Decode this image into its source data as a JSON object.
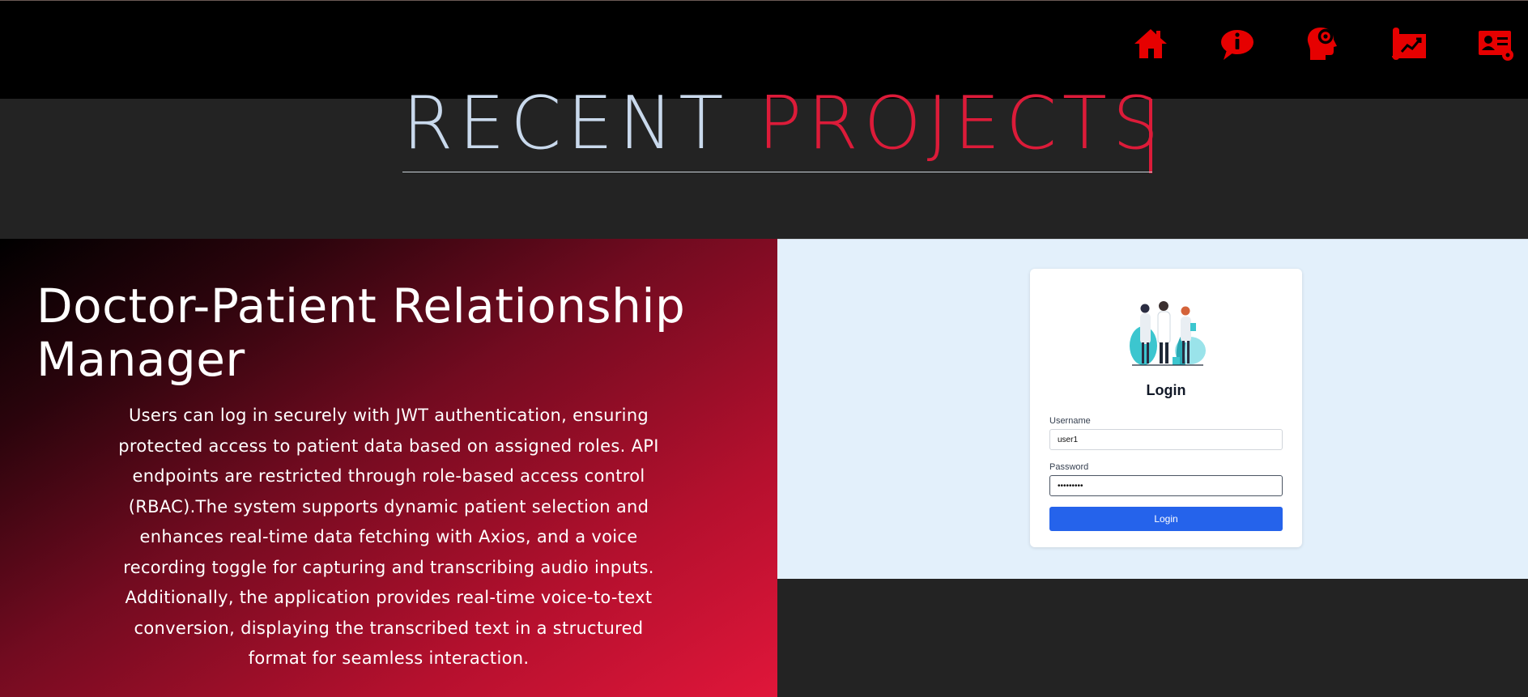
{
  "nav": {
    "icons": [
      "home-icon",
      "about-icon",
      "skills-icon",
      "projects-icon",
      "contact-icon"
    ],
    "accent": "#e60000"
  },
  "heading": {
    "word1": "RECENT",
    "word2": "PROJECTS"
  },
  "project": {
    "title": "Doctor-Patient Relationship Manager",
    "description": "Users can log in securely with JWT authentication, ensuring protected access to patient data based on assigned roles. API endpoints are restricted through role-based access control (RBAC).The system supports dynamic patient selection and enhances real-time data fetching with Axios, and a voice recording toggle for capturing and transcribing audio inputs. Additionally, the application provides real-time voice-to-text conversion, displaying the transcribed text in a structured format for seamless interaction."
  },
  "preview": {
    "login_title": "Login",
    "username_label": "Username",
    "username_value": "user1",
    "password_label": "Password",
    "password_value": "•••••••••",
    "button_label": "Login"
  },
  "colors": {
    "accent_red": "#dc1b39",
    "heading_light": "#c9d9ec",
    "page_bg": "#232323",
    "login_button": "#2563eb"
  }
}
